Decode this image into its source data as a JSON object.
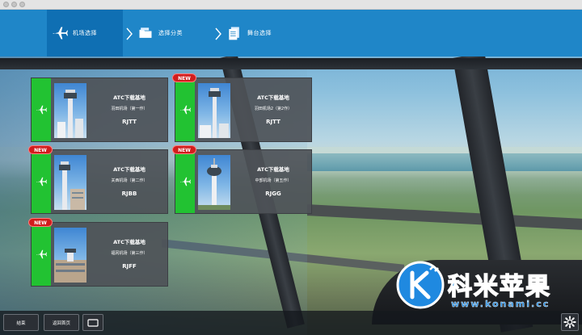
{
  "nav": {
    "tabs": [
      {
        "label": "机场选择",
        "icon": "airplane-icon",
        "active": true
      },
      {
        "label": "选择分类",
        "icon": "folder-icon",
        "active": false
      },
      {
        "label": "舞台选择",
        "icon": "document-icon",
        "active": false
      }
    ]
  },
  "cards": [
    {
      "title": "ATC下载基地",
      "subtitle": "羽田机场（第一作）",
      "code": "RJTT",
      "is_new": false
    },
    {
      "title": "ATC下载基地",
      "subtitle": "羽田机场2（第2作）",
      "code": "RJTT",
      "is_new": true,
      "badge": "NEW"
    },
    {
      "title": "ATC下载基地",
      "subtitle": "关西机场（第二作）",
      "code": "RJBB",
      "is_new": true,
      "badge": "NEW"
    },
    {
      "title": "ATC下载基地",
      "subtitle": "中部机场（第五作）",
      "code": "RJGG",
      "is_new": true,
      "badge": "NEW"
    },
    {
      "title": "ATC下载基地",
      "subtitle": "福冈机场（第三作）",
      "code": "RJFF",
      "is_new": true,
      "badge": "NEW"
    }
  ],
  "bottom": {
    "end_label": "结束",
    "back_label": "返回首页"
  },
  "watermark": {
    "text": "科米苹果",
    "url": "www.konami.cc"
  },
  "colors": {
    "nav_bg": "#1f86c8",
    "nav_active": "#0f6fb3",
    "card_strip": "#22c232",
    "badge": "#d11d1d",
    "card_bg": "#4e5258"
  }
}
